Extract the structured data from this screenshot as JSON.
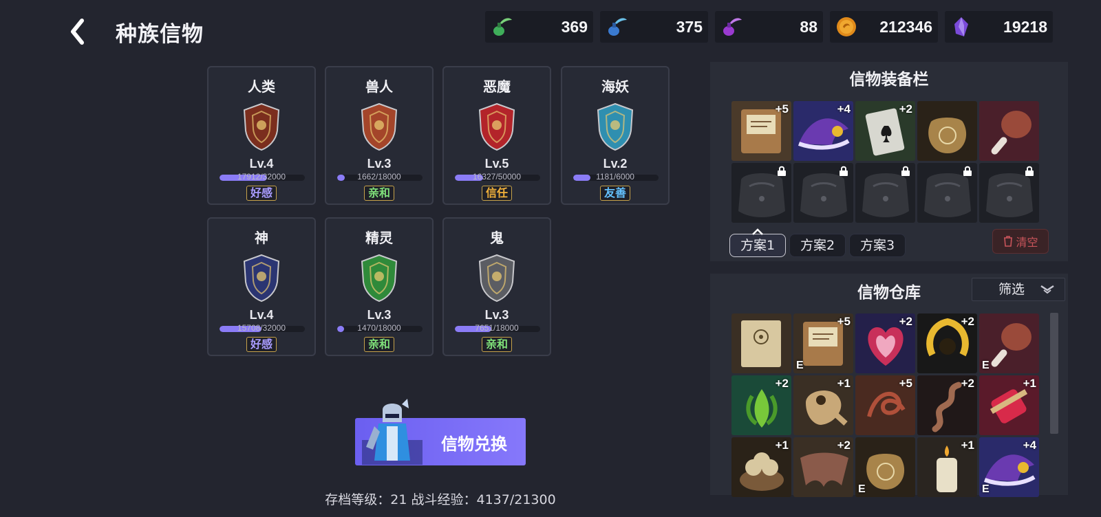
{
  "header": {
    "title": "种族信物"
  },
  "currencies": [
    {
      "icon": "green-potion-icon",
      "value": "369"
    },
    {
      "icon": "blue-potion-icon",
      "value": "375"
    },
    {
      "icon": "purple-potion-icon",
      "value": "88"
    },
    {
      "icon": "gold-coin-icon",
      "value": "212346"
    },
    {
      "icon": "purple-crystal-icon",
      "value": "19218"
    }
  ],
  "races": [
    {
      "name": "人类",
      "level": "Lv.4",
      "exp": "17912/32000",
      "progress": 0.56,
      "relation": "好感",
      "relation_color": "#a99cff",
      "shield_color": "#7b2e1e"
    },
    {
      "name": "兽人",
      "level": "Lv.3",
      "exp": "1662/18000",
      "progress": 0.09,
      "relation": "亲和",
      "relation_color": "#7fe07a",
      "shield_color": "#a4452a"
    },
    {
      "name": "恶魔",
      "level": "Lv.5",
      "exp": "16327/50000",
      "progress": 0.33,
      "relation": "信任",
      "relation_color": "#f3b23a",
      "shield_color": "#b3242a"
    },
    {
      "name": "海妖",
      "level": "Lv.2",
      "exp": "1181/6000",
      "progress": 0.2,
      "relation": "友善",
      "relation_color": "#64c2ff",
      "shield_color": "#2f8fb0"
    },
    {
      "name": "神",
      "level": "Lv.4",
      "exp": "15708/32000",
      "progress": 0.49,
      "relation": "好感",
      "relation_color": "#a99cff",
      "shield_color": "#2b3572"
    },
    {
      "name": "精灵",
      "level": "Lv.3",
      "exp": "1470/18000",
      "progress": 0.08,
      "relation": "亲和",
      "relation_color": "#7fe07a",
      "shield_color": "#2f8a3a"
    },
    {
      "name": "鬼",
      "level": "Lv.3",
      "exp": "7651/18000",
      "progress": 0.43,
      "relation": "亲和",
      "relation_color": "#7fe07a",
      "shield_color": "#5b5d63"
    }
  ],
  "exchange": {
    "label": "信物兑换"
  },
  "footer": {
    "save_info": "存档等级：21 战斗经验：4137/21300"
  },
  "equip_panel": {
    "title": "信物装备栏",
    "slots": [
      {
        "item": "book",
        "plus": "+5",
        "bg": "#4a3a2a",
        "color": "#a87a4a"
      },
      {
        "item": "hat",
        "plus": "+4",
        "bg": "#2a2a6a",
        "color": "#6a3ab0"
      },
      {
        "item": "card",
        "plus": "+2",
        "bg": "#2a3a2a",
        "color": "#d8d8d0"
      },
      {
        "item": "sack",
        "plus": "",
        "bg": "#2a2218",
        "color": "#a8844a"
      },
      {
        "item": "drumstick",
        "plus": "",
        "bg": "#4a1f2a",
        "color": "#9a4a3a"
      },
      {
        "item": "locked",
        "plus": ""
      },
      {
        "item": "locked",
        "plus": ""
      },
      {
        "item": "locked",
        "plus": ""
      },
      {
        "item": "locked",
        "plus": ""
      },
      {
        "item": "locked",
        "plus": ""
      }
    ],
    "presets": [
      "方案1",
      "方案2",
      "方案3"
    ],
    "active_preset": 0,
    "clear_label": "清空"
  },
  "warehouse_panel": {
    "title": "信物仓库",
    "filter_label": "筛选",
    "slots": [
      {
        "item": "scroll",
        "plus": "",
        "e": "",
        "bg": "#3a2f24",
        "color": "#d8c8a0"
      },
      {
        "item": "book",
        "plus": "+5",
        "e": "E",
        "bg": "#3a2f24",
        "color": "#a87a4a"
      },
      {
        "item": "heart",
        "plus": "+2",
        "e": "",
        "bg": "#24204a",
        "color": "#c8305a"
      },
      {
        "item": "laurel",
        "plus": "+2",
        "e": "",
        "bg": "#181818",
        "color": "#e8b830"
      },
      {
        "item": "drumstick",
        "plus": "",
        "e": "E",
        "bg": "#4a1f2a",
        "color": "#9a4a3a"
      },
      {
        "item": "herb",
        "plus": "+2",
        "e": "",
        "bg": "#1a4a38",
        "color": "#78c83a"
      },
      {
        "item": "skull",
        "plus": "+1",
        "e": "",
        "bg": "#3a2f24",
        "color": "#c8a878"
      },
      {
        "item": "rope",
        "plus": "+5",
        "e": "",
        "bg": "#4a2a20",
        "color": "#b0503a"
      },
      {
        "item": "snake",
        "plus": "+2",
        "e": "",
        "bg": "#201818",
        "color": "#a06a50"
      },
      {
        "item": "thread",
        "plus": "+1",
        "e": "",
        "bg": "#5a1a2a",
        "color": "#d82a4a"
      },
      {
        "item": "skulls",
        "plus": "+1",
        "e": "",
        "bg": "#2a2218",
        "color": "#d8c8a0"
      },
      {
        "item": "wing",
        "plus": "+2",
        "e": "",
        "bg": "#3a2f24",
        "color": "#8a5a4a"
      },
      {
        "item": "sack",
        "plus": "",
        "e": "E",
        "bg": "#2a2218",
        "color": "#a8844a"
      },
      {
        "item": "candle",
        "plus": "+1",
        "e": "",
        "bg": "#2a2520",
        "color": "#e8e0c8"
      },
      {
        "item": "hat",
        "plus": "+4",
        "e": "E",
        "bg": "#2a2a6a",
        "color": "#6a3ab0"
      }
    ]
  }
}
